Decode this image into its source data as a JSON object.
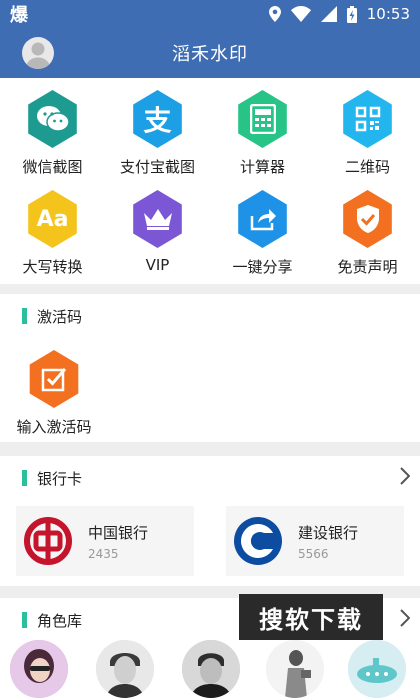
{
  "status": {
    "left_glyph": "爆",
    "time": "10:53"
  },
  "header": {
    "title": "滔禾水印"
  },
  "grid": [
    {
      "label": "微信截图",
      "icon": "wechat-icon",
      "color": "#1e9b91"
    },
    {
      "label": "支付宝截图",
      "icon": "alipay-icon",
      "color": "#1d9fe6"
    },
    {
      "label": "计算器",
      "icon": "calculator-icon",
      "color": "#27c387"
    },
    {
      "label": "二维码",
      "icon": "qrcode-icon",
      "color": "#22b5ee"
    },
    {
      "label": "大写转换",
      "icon": "text-case-icon",
      "color": "#f5c41c"
    },
    {
      "label": "VIP",
      "icon": "crown-icon",
      "color": "#7b57d6"
    },
    {
      "label": "一键分享",
      "icon": "share-icon",
      "color": "#1e92e6"
    },
    {
      "label": "免责声明",
      "icon": "shield-check-icon",
      "color": "#f2701f"
    }
  ],
  "activation": {
    "title": "激活码",
    "item_label": "输入激活码",
    "icon_color": "#f2701f"
  },
  "banks": {
    "title": "银行卡",
    "cards": [
      {
        "name": "中国银行",
        "number": "2435",
        "color": "#c4152d"
      },
      {
        "name": "建设银行",
        "number": "5566",
        "color": "#0c4da2"
      }
    ]
  },
  "roles": {
    "title": "角色库"
  },
  "watermark": {
    "text": "搜软下载"
  },
  "accent": "#2bbf9b",
  "bar_color": "#3f6db3"
}
